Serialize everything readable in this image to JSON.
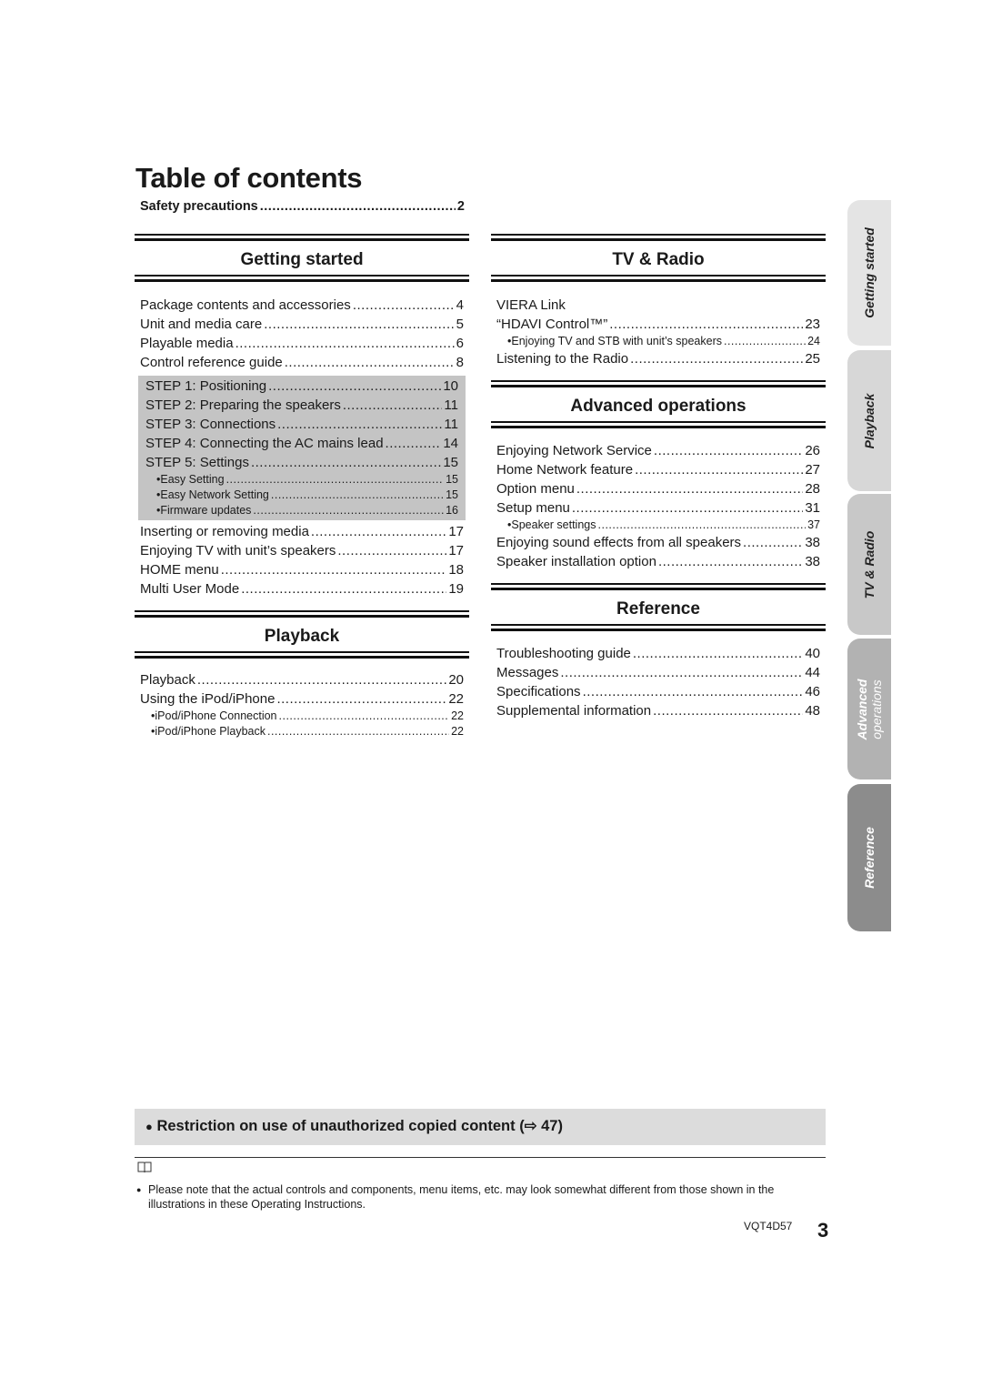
{
  "page": {
    "title": "Table of contents",
    "safety": {
      "label": "Safety precautions",
      "page": "2"
    }
  },
  "sections": {
    "getting_started": {
      "title": "Getting started",
      "entries": [
        {
          "label": "Package contents and accessories",
          "page": "4"
        },
        {
          "label": "Unit and media care",
          "page": "5"
        },
        {
          "label": "Playable media",
          "page": "6"
        },
        {
          "label": "Control reference guide",
          "page": "8"
        }
      ],
      "steps": [
        {
          "label": "STEP 1: Positioning",
          "page": "10"
        },
        {
          "label": "STEP 2: Preparing the speakers",
          "page": "11"
        },
        {
          "label": "STEP 3: Connections",
          "page": "11"
        },
        {
          "label": "STEP 4: Connecting the AC mains lead",
          "page": "14"
        },
        {
          "label": "STEP 5: Settings",
          "page": "15"
        }
      ],
      "step_subs": [
        {
          "label": "•Easy Setting",
          "page": "15"
        },
        {
          "label": "•Easy Network Setting",
          "page": "15"
        },
        {
          "label": "•Firmware updates",
          "page": "16"
        }
      ],
      "after": [
        {
          "label": "Inserting or removing media",
          "page": "17"
        },
        {
          "label": "Enjoying TV with unit’s speakers",
          "page": "17"
        },
        {
          "label": "HOME menu",
          "page": "18"
        },
        {
          "label": "Multi User Mode",
          "page": "19"
        }
      ]
    },
    "playback": {
      "title": "Playback",
      "entries": [
        {
          "label": "Playback",
          "page": "20"
        },
        {
          "label": "Using the iPod/iPhone",
          "page": "22"
        }
      ],
      "subs": [
        {
          "label": "•iPod/iPhone Connection",
          "page": "22"
        },
        {
          "label": "•iPod/iPhone Playback",
          "page": "22"
        }
      ]
    },
    "tv_radio": {
      "title": "TV & Radio",
      "viera_line": "VIERA Link",
      "hdavi": {
        "label": "“HDAVI Control™”",
        "page": "23"
      },
      "sub": {
        "label": "•Enjoying TV and STB with unit’s speakers",
        "page": "24"
      },
      "radio": {
        "label": "Listening to the Radio",
        "page": "25"
      }
    },
    "advanced": {
      "title": "Advanced operations",
      "entries": [
        {
          "label": "Enjoying Network Service",
          "page": "26"
        },
        {
          "label": "Home Network feature",
          "page": "27"
        },
        {
          "label": "Option menu",
          "page": "28"
        },
        {
          "label": "Setup menu",
          "page": "31"
        }
      ],
      "sub": {
        "label": "•Speaker settings",
        "page": "37"
      },
      "after": [
        {
          "label": "Enjoying sound effects from all speakers",
          "page": "38"
        },
        {
          "label": "Speaker installation option",
          "page": "38"
        }
      ]
    },
    "reference": {
      "title": "Reference",
      "entries": [
        {
          "label": "Troubleshooting guide",
          "page": "40"
        },
        {
          "label": "Messages",
          "page": "44"
        },
        {
          "label": "Specifications",
          "page": "46"
        },
        {
          "label": "Supplemental information",
          "page": "48"
        }
      ]
    }
  },
  "side_tabs": [
    {
      "label": "Getting started",
      "color": "#e4e4e4",
      "text_color": "#222222"
    },
    {
      "label": "Playback",
      "color": "#d7d7d7",
      "text_color": "#222222"
    },
    {
      "label": "TV & Radio",
      "color": "#c8c8c8",
      "text_color": "#222222"
    },
    {
      "label": "Advanced operations",
      "line1": "Advanced",
      "line2": "operations",
      "color": "#b2b2b2",
      "text_color": "#ffffff"
    },
    {
      "label": "Reference",
      "color": "#8c8c8c",
      "text_color": "#ffffff"
    }
  ],
  "restriction": {
    "bullet": "●",
    "text": "Restriction on use of unauthorized copied content (⇨ 47)"
  },
  "note": {
    "bullet": "●",
    "text": "Please note that the actual controls and components, menu items, etc. may look somewhat different from those shown in the illustrations in these Operating Instructions."
  },
  "footer": {
    "model_code": "VQT4D57",
    "page_number": "3"
  },
  "colors": {
    "shaded": "#c4c4c4",
    "restriction_bg": "#dcdcdc"
  }
}
